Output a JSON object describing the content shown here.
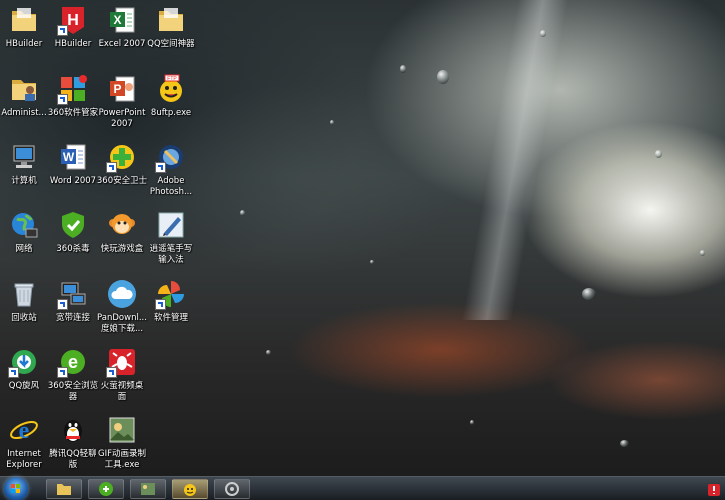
{
  "desktop_icons": {
    "hbuilder_folder": "HBuilder",
    "hbuilder_app": "HBuilder",
    "excel_2007": "Excel 2007",
    "qq_space": "QQ空间神器",
    "administrator": "Administ...",
    "soft_manager_360": "360软件管家",
    "powerpoint_2007": "PowerPoint\n2007",
    "8uftp": "8uftp.exe",
    "computer": "计算机",
    "word_2007": "Word 2007",
    "safe_guard_360": "360安全卫士",
    "photoshop": "Adobe\nPhotosh...",
    "network": "网络",
    "antivirus_360": "360杀毒",
    "game_box": "快玩游戏盒",
    "handwriting": "逍遥笔手写\n输入法",
    "recycle_bin": "回收站",
    "broadband": "宽带连接",
    "pan_download": "PanDownl...\n度娘下载...",
    "software_manager": "软件管理",
    "qq_whirlwind": "QQ旋风",
    "browser_360": "360安全浏览\n器",
    "video_desktop": "火萤视频桌\n面",
    "ie": "Internet\nExplorer",
    "qq_light": "腾讯QQ轻聊\n版",
    "gif_recorder": "GIF动画录制\n工具.exe"
  },
  "colors": {
    "ie_blue": "#1e78d2",
    "green_360": "#4caf23",
    "red_app": "#d8232a",
    "folder_yellow": "#e8c35a"
  }
}
